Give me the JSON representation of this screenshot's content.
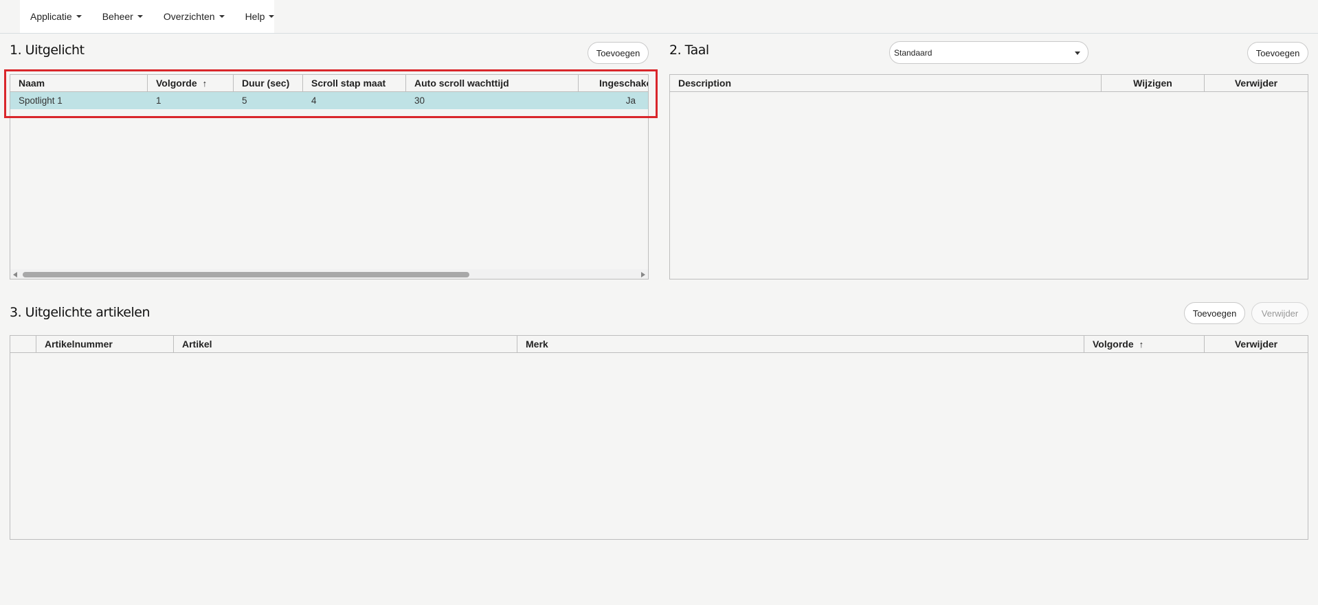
{
  "nav": {
    "items": [
      {
        "label": "Applicatie"
      },
      {
        "label": "Beheer"
      },
      {
        "label": "Overzichten"
      },
      {
        "label": "Help"
      }
    ]
  },
  "section1": {
    "title": "1. Uitgelicht",
    "add_label": "Toevoegen",
    "columns": [
      "Naam",
      "Volgorde",
      "Duur (sec)",
      "Scroll stap maat",
      "Auto scroll wachttijd",
      "Ingeschakel"
    ],
    "sort_icon": "arrow-up-icon",
    "rows": [
      {
        "naam": "Spotlight 1",
        "volgorde": "1",
        "duur": "5",
        "scroll": "4",
        "wachttijd": "30",
        "ingeschakeld": "Ja"
      }
    ],
    "selected_row_color": "#bfe2e5"
  },
  "section2": {
    "title": "2. Taal",
    "select_value": "Standaard",
    "add_label": "Toevoegen",
    "columns": [
      "Description",
      "Wijzigen",
      "Verwijder"
    ]
  },
  "section3": {
    "title": "3. Uitgelichte artikelen",
    "add_label": "Toevoegen",
    "remove_label": "Verwijder",
    "columns": [
      "",
      "Artikelnummer",
      "Artikel",
      "Merk",
      "Volgorde",
      "Verwijder"
    ]
  },
  "colors": {
    "background": "#f5f5f4",
    "highlight": "#d9262b",
    "selected_row": "#bfe2e5"
  }
}
